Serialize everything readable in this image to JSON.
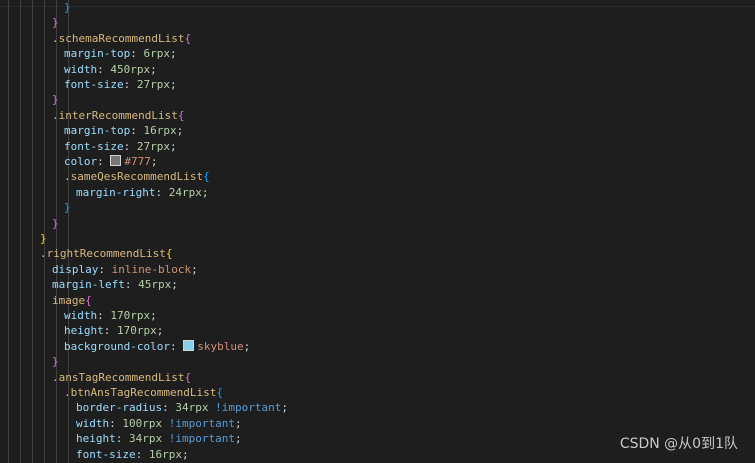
{
  "editor": {
    "theme_colors": {
      "background": "#1e1e1e",
      "selector": "#d7ba7d",
      "property": "#9cdcfe",
      "number": "#b5cea8",
      "value": "#ce9178",
      "important": "#569cd6"
    },
    "lines": [
      {
        "indent": 5,
        "tokens": [
          {
            "t": "}",
            "c": "tok-brace b"
          }
        ]
      },
      {
        "indent": 4,
        "tokens": [
          {
            "t": "}",
            "c": "tok-brace"
          }
        ]
      },
      {
        "indent": 4,
        "tokens": [
          {
            "t": ".schemaRecommendList",
            "c": "tok-selector"
          },
          {
            "t": "{",
            "c": "tok-brace"
          }
        ]
      },
      {
        "indent": 5,
        "tokens": [
          {
            "t": "margin-top",
            "c": "tok-prop"
          },
          {
            "t": ": ",
            "c": "tok-punct"
          },
          {
            "t": "6rpx",
            "c": "tok-num"
          },
          {
            "t": ";",
            "c": "tok-punct"
          }
        ]
      },
      {
        "indent": 5,
        "tokens": [
          {
            "t": "width",
            "c": "tok-prop"
          },
          {
            "t": ": ",
            "c": "tok-punct"
          },
          {
            "t": "450rpx",
            "c": "tok-num"
          },
          {
            "t": ";",
            "c": "tok-punct"
          }
        ]
      },
      {
        "indent": 5,
        "tokens": [
          {
            "t": "font-size",
            "c": "tok-prop"
          },
          {
            "t": ": ",
            "c": "tok-punct"
          },
          {
            "t": "27rpx",
            "c": "tok-num"
          },
          {
            "t": ";",
            "c": "tok-punct"
          }
        ]
      },
      {
        "indent": 4,
        "tokens": [
          {
            "t": "}",
            "c": "tok-brace"
          }
        ]
      },
      {
        "indent": 4,
        "tokens": [
          {
            "t": ".interRecommendList",
            "c": "tok-selector"
          },
          {
            "t": "{",
            "c": "tok-brace"
          }
        ]
      },
      {
        "indent": 5,
        "tokens": [
          {
            "t": "margin-top",
            "c": "tok-prop"
          },
          {
            "t": ": ",
            "c": "tok-punct"
          },
          {
            "t": "16rpx",
            "c": "tok-num"
          },
          {
            "t": ";",
            "c": "tok-punct"
          }
        ]
      },
      {
        "indent": 5,
        "tokens": [
          {
            "t": "font-size",
            "c": "tok-prop"
          },
          {
            "t": ": ",
            "c": "tok-punct"
          },
          {
            "t": "27rpx",
            "c": "tok-num"
          },
          {
            "t": ";",
            "c": "tok-punct"
          }
        ]
      },
      {
        "indent": 5,
        "tokens": [
          {
            "t": "color",
            "c": "tok-prop"
          },
          {
            "t": ": ",
            "c": "tok-punct"
          },
          {
            "swatch": "#777777"
          },
          {
            "t": "#777",
            "c": "tok-value"
          },
          {
            "t": ";",
            "c": "tok-punct"
          }
        ]
      },
      {
        "indent": 5,
        "tokens": [
          {
            "t": ".sameQesRecommendList",
            "c": "tok-selector"
          },
          {
            "t": "{",
            "c": "tok-brace b"
          }
        ]
      },
      {
        "indent": 6,
        "tokens": [
          {
            "t": "margin-right",
            "c": "tok-prop"
          },
          {
            "t": ": ",
            "c": "tok-punct"
          },
          {
            "t": "24rpx",
            "c": "tok-num"
          },
          {
            "t": ";",
            "c": "tok-punct"
          }
        ]
      },
      {
        "indent": 5,
        "tokens": [
          {
            "t": "}",
            "c": "tok-brace b"
          }
        ]
      },
      {
        "indent": 4,
        "tokens": [
          {
            "t": "}",
            "c": "tok-brace"
          }
        ]
      },
      {
        "indent": 3,
        "tokens": [
          {
            "t": "}",
            "c": "tok-brace y"
          }
        ]
      },
      {
        "indent": 3,
        "tokens": [
          {
            "t": ".rightRecommendList",
            "c": "tok-selector"
          },
          {
            "t": "{",
            "c": "tok-brace y"
          }
        ]
      },
      {
        "indent": 4,
        "tokens": [
          {
            "t": "display",
            "c": "tok-prop"
          },
          {
            "t": ": ",
            "c": "tok-punct"
          },
          {
            "t": "inline-block",
            "c": "tok-value"
          },
          {
            "t": ";",
            "c": "tok-punct"
          }
        ]
      },
      {
        "indent": 4,
        "tokens": [
          {
            "t": "margin-left",
            "c": "tok-prop"
          },
          {
            "t": ": ",
            "c": "tok-punct"
          },
          {
            "t": "45rpx",
            "c": "tok-num"
          },
          {
            "t": ";",
            "c": "tok-punct"
          }
        ]
      },
      {
        "indent": 4,
        "tokens": [
          {
            "t": "image",
            "c": "tok-tag"
          },
          {
            "t": "{",
            "c": "tok-brace"
          }
        ]
      },
      {
        "indent": 5,
        "tokens": [
          {
            "t": "width",
            "c": "tok-prop"
          },
          {
            "t": ": ",
            "c": "tok-punct"
          },
          {
            "t": "170rpx",
            "c": "tok-num"
          },
          {
            "t": ";",
            "c": "tok-punct"
          }
        ]
      },
      {
        "indent": 5,
        "tokens": [
          {
            "t": "height",
            "c": "tok-prop"
          },
          {
            "t": ": ",
            "c": "tok-punct"
          },
          {
            "t": "170rpx",
            "c": "tok-num"
          },
          {
            "t": ";",
            "c": "tok-punct"
          }
        ]
      },
      {
        "indent": 5,
        "tokens": [
          {
            "t": "background-color",
            "c": "tok-prop"
          },
          {
            "t": ": ",
            "c": "tok-punct"
          },
          {
            "swatch": "#87ceeb"
          },
          {
            "t": "skyblue",
            "c": "tok-value"
          },
          {
            "t": ";",
            "c": "tok-punct"
          }
        ]
      },
      {
        "indent": 4,
        "tokens": [
          {
            "t": "}",
            "c": "tok-brace"
          }
        ]
      },
      {
        "indent": 4,
        "tokens": [
          {
            "t": ".ansTagRecommendList",
            "c": "tok-selector"
          },
          {
            "t": "{",
            "c": "tok-brace"
          }
        ]
      },
      {
        "indent": 5,
        "tokens": [
          {
            "t": ".btnAnsTagRecommendList",
            "c": "tok-selector"
          },
          {
            "t": "{",
            "c": "tok-brace b"
          }
        ]
      },
      {
        "indent": 6,
        "tokens": [
          {
            "t": "border-radius",
            "c": "tok-prop"
          },
          {
            "t": ": ",
            "c": "tok-punct"
          },
          {
            "t": "34rpx",
            "c": "tok-num"
          },
          {
            "t": " ",
            "c": "tok-punct"
          },
          {
            "t": "!important",
            "c": "tok-important"
          },
          {
            "t": ";",
            "c": "tok-punct"
          }
        ]
      },
      {
        "indent": 6,
        "tokens": [
          {
            "t": "width",
            "c": "tok-prop"
          },
          {
            "t": ": ",
            "c": "tok-punct"
          },
          {
            "t": "100rpx",
            "c": "tok-num"
          },
          {
            "t": " ",
            "c": "tok-punct"
          },
          {
            "t": "!important",
            "c": "tok-important"
          },
          {
            "t": ";",
            "c": "tok-punct"
          }
        ]
      },
      {
        "indent": 6,
        "tokens": [
          {
            "t": "height",
            "c": "tok-prop"
          },
          {
            "t": ": ",
            "c": "tok-punct"
          },
          {
            "t": "34rpx",
            "c": "tok-num"
          },
          {
            "t": " ",
            "c": "tok-punct"
          },
          {
            "t": "!important",
            "c": "tok-important"
          },
          {
            "t": ";",
            "c": "tok-punct"
          }
        ]
      },
      {
        "indent": 6,
        "tokens": [
          {
            "t": "font-size",
            "c": "tok-prop"
          },
          {
            "t": ": ",
            "c": "tok-punct"
          },
          {
            "t": "16rpx",
            "c": "tok-num"
          },
          {
            "t": ";",
            "c": "tok-punct"
          }
        ]
      }
    ]
  },
  "watermark": {
    "text": "CSDN @从0到1队"
  }
}
